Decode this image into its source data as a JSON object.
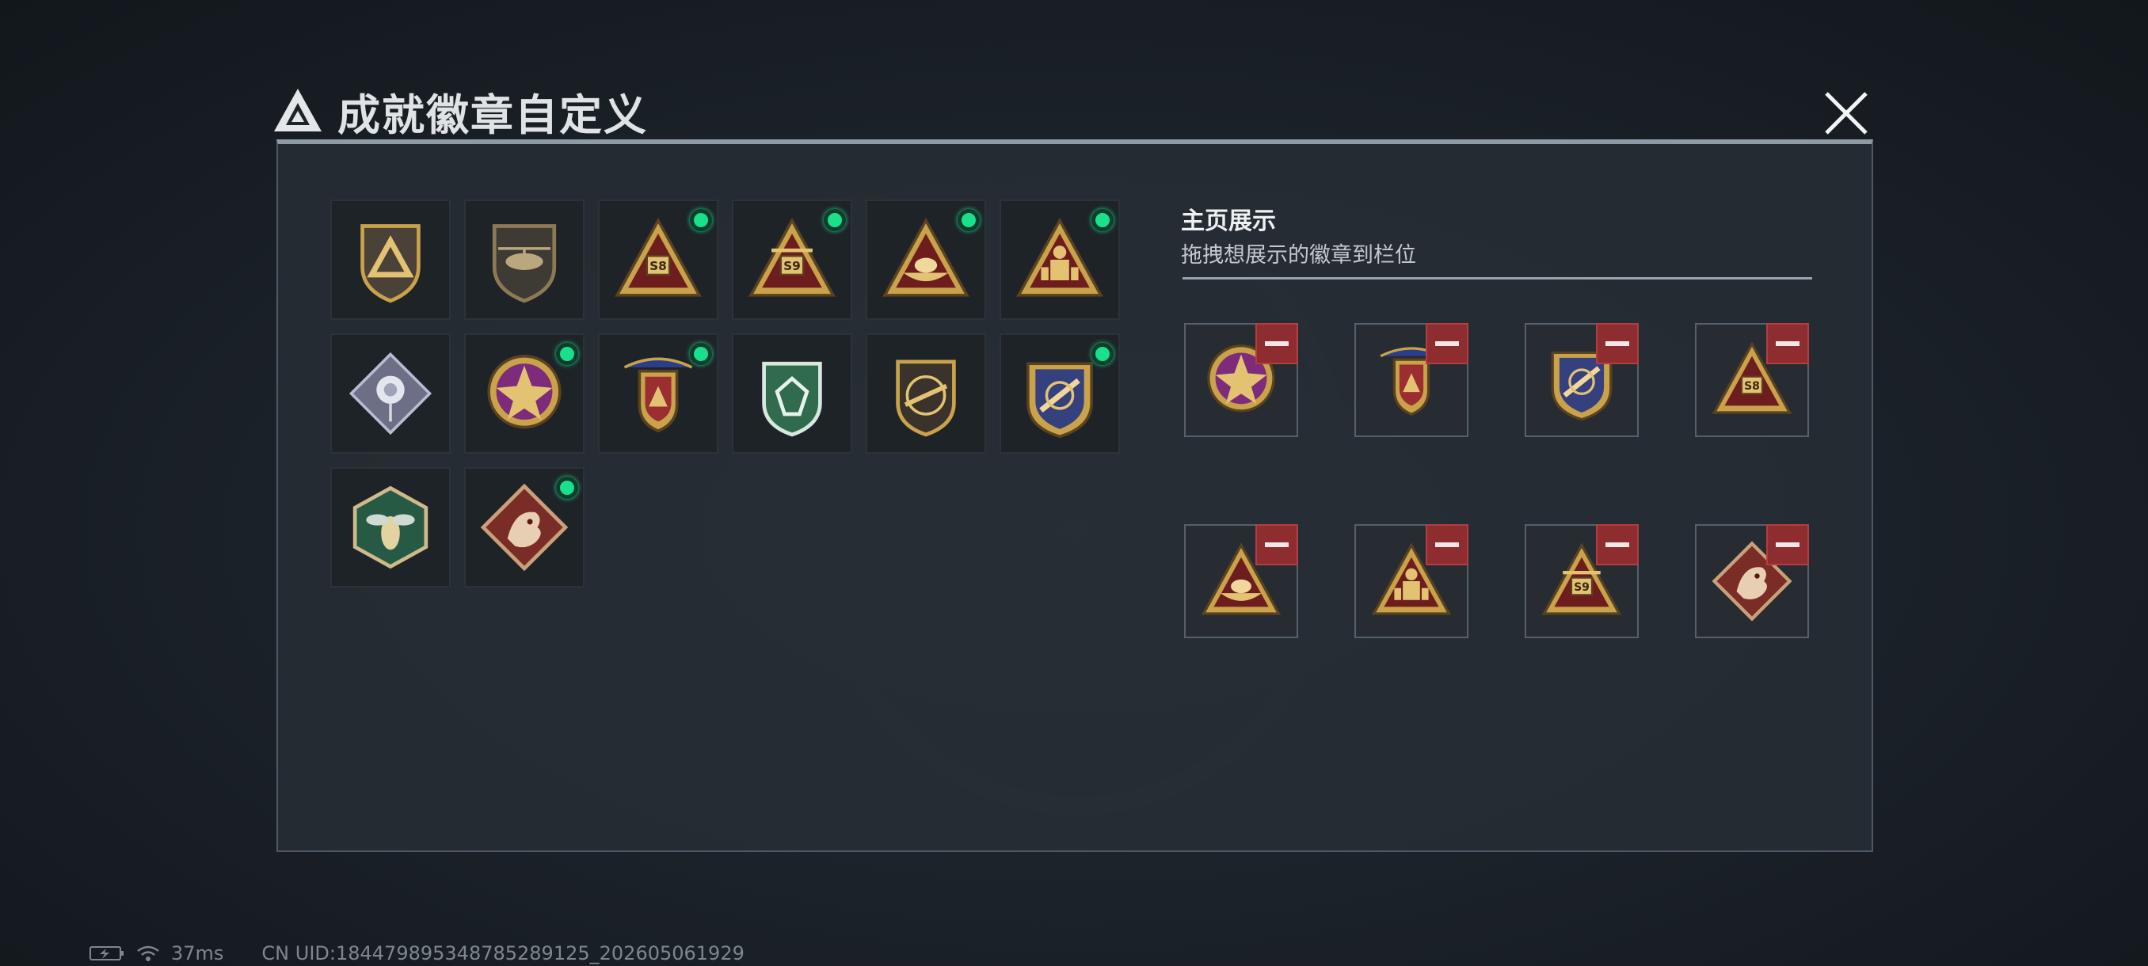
{
  "window": {
    "title": "成就徽章自定义"
  },
  "badge_collection": [
    {
      "icon": "delta-shield-badge-icon",
      "is_new": false
    },
    {
      "icon": "helicopter-shield-badge-icon",
      "is_new": false
    },
    {
      "icon": "s8-triangle-badge-icon",
      "is_new": true,
      "label": "S8"
    },
    {
      "icon": "s9-triangle-badge-icon",
      "is_new": true,
      "label": "S9"
    },
    {
      "icon": "boat-triangle-badge-icon",
      "is_new": true
    },
    {
      "icon": "soldier-triangle-badge-icon",
      "is_new": true
    },
    {
      "icon": "silver-rose-badge-icon",
      "is_new": false
    },
    {
      "icon": "star-medal-badge-icon",
      "is_new": true
    },
    {
      "icon": "wings-crest-badge-icon",
      "is_new": true
    },
    {
      "icon": "green-gem-shield-badge-icon",
      "is_new": false
    },
    {
      "icon": "rifle-shield-badge-icon",
      "is_new": false
    },
    {
      "icon": "jet-shield-badge-icon",
      "is_new": true
    },
    {
      "icon": "wasp-hexagon-badge-icon",
      "is_new": false
    },
    {
      "icon": "dragon-diamond-badge-icon",
      "is_new": true
    }
  ],
  "display_panel": {
    "title": "主页展示",
    "subtitle": "拖拽想展示的徽章到栏位",
    "slots": [
      {
        "icon": "star-medal-badge-icon"
      },
      {
        "icon": "wings-crest-badge-icon"
      },
      {
        "icon": "jet-shield-badge-icon"
      },
      {
        "icon": "s8-triangle-badge-icon",
        "label": "S8"
      },
      {
        "icon": "boat-triangle-badge-icon"
      },
      {
        "icon": "soldier-triangle-badge-icon"
      },
      {
        "icon": "s9-triangle-badge-icon",
        "label": "S9"
      },
      {
        "icon": "dragon-diamond-badge-icon"
      }
    ]
  },
  "status_bar": {
    "ping": "37ms",
    "uid": "CN UID:1844798953487852891​25_202605061929"
  },
  "colors": {
    "gold": "#c9a24a",
    "gold_light": "#e3c372",
    "new_indicator": "#19e08a",
    "remove_red": "#8e2d30"
  }
}
